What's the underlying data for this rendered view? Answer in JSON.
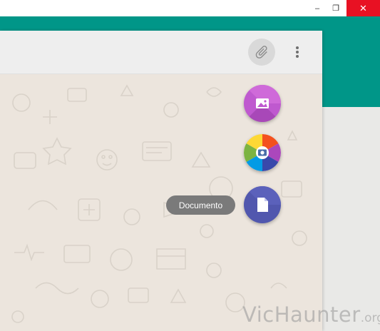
{
  "window": {
    "minimize_glyph": "–",
    "restore_glyph": "❐",
    "close_glyph": "✕"
  },
  "header": {
    "attach_icon": "paperclip-icon",
    "menu_icon": "more-vertical-icon"
  },
  "attach_menu": {
    "items": [
      {
        "id": "gallery",
        "icon": "image-icon",
        "color": "#bf59cf"
      },
      {
        "id": "camera",
        "icon": "camera-icon",
        "color": "#f4511e"
      },
      {
        "id": "document",
        "icon": "document-icon",
        "color": "#5157ae"
      }
    ],
    "tooltip": "Documento"
  },
  "watermark": {
    "main": "VicHaunter",
    "tld": ".org"
  },
  "colors": {
    "teal": "#009688",
    "chat_background": "#ece5dd",
    "header": "#eeeeee",
    "tooltip": "#7a7a7a"
  }
}
